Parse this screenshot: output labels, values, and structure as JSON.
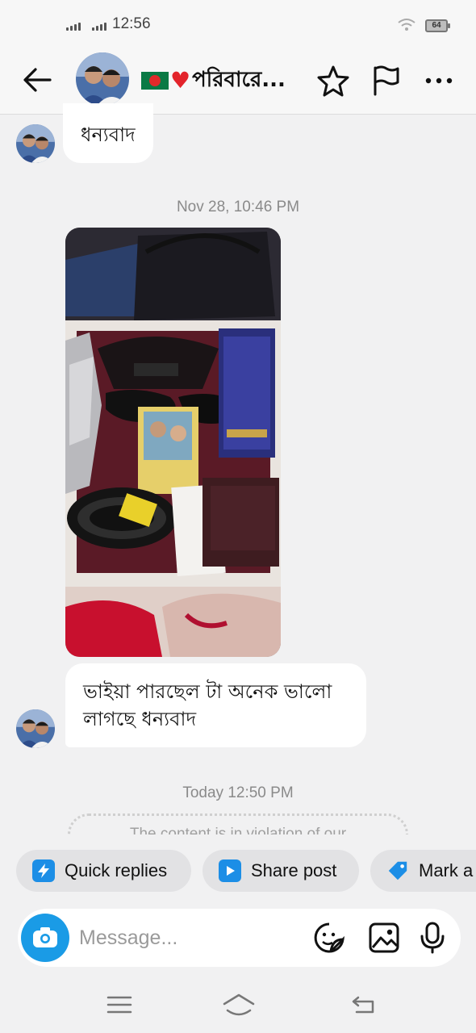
{
  "status_bar": {
    "time": "12:56",
    "battery": "64"
  },
  "header": {
    "title": "পরিবারে...",
    "icons": [
      "back-arrow-icon",
      "bangladesh-flag-icon",
      "heart-icon",
      "star-icon",
      "flag-icon",
      "more-icon"
    ]
  },
  "messages": [
    {
      "text": "ধন্যবাদ"
    },
    {
      "timestamp": "Nov 28, 10:46 PM"
    },
    {
      "line1": "ভাইয়া পারছেল টা অনেক ভালো",
      "line2": "লাগছে ধন্যবাদ"
    },
    {
      "timestamp": "Today 12:50 PM"
    }
  ],
  "notice": {
    "text": "The content is in violation of our"
  },
  "quick_actions": [
    {
      "label": "Quick replies",
      "icon": "lightning-icon"
    },
    {
      "label": "Share post",
      "icon": "play-icon"
    },
    {
      "label": "Mark a",
      "icon": "tag-icon"
    }
  ],
  "composer": {
    "placeholder": "Message..."
  },
  "colors": {
    "accent": "#1a9be6",
    "background": "#f1f1f2",
    "bubble": "#ffffff",
    "heart": "#e3242b",
    "flag_green": "#0a7a45"
  }
}
